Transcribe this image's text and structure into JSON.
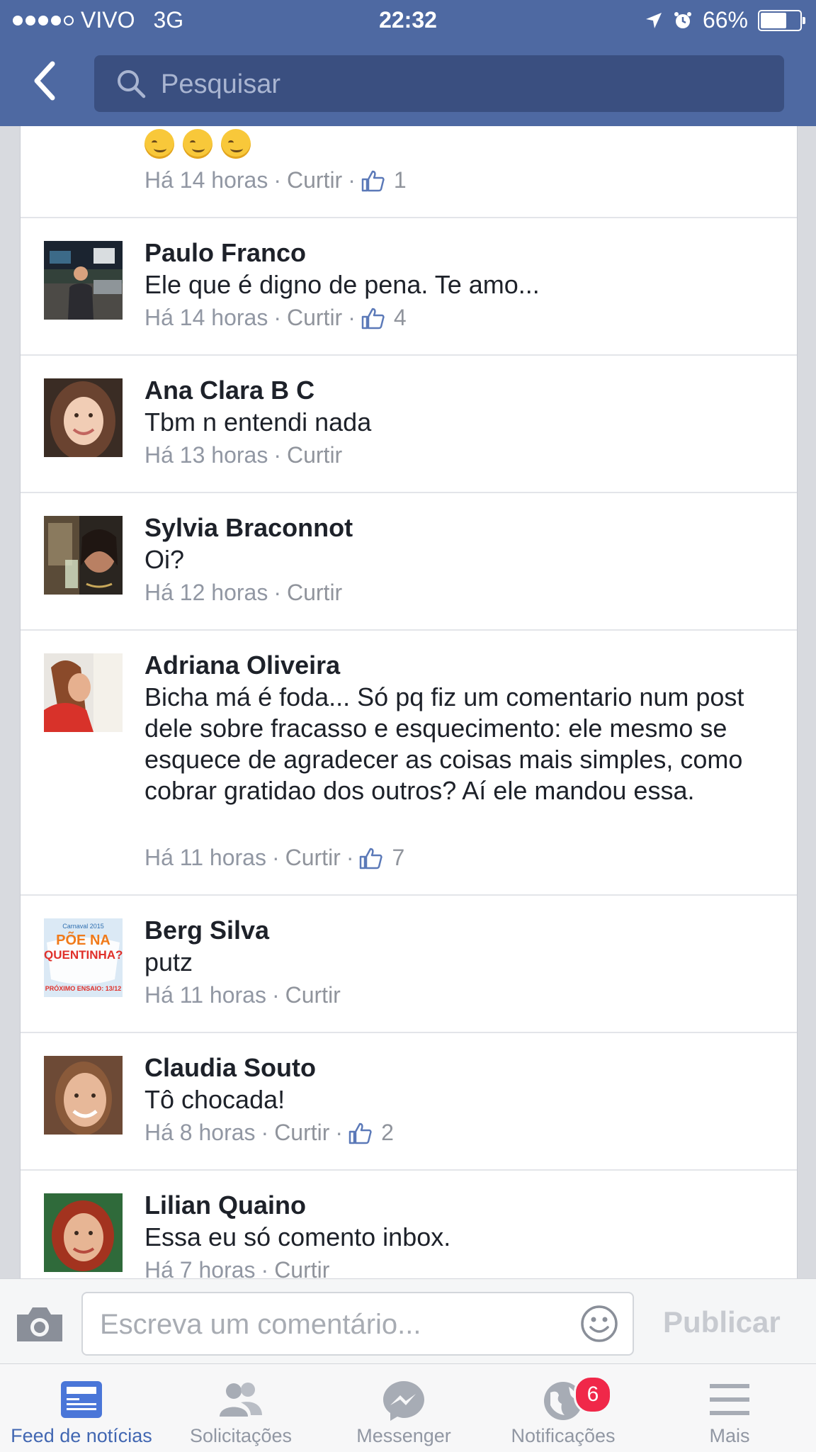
{
  "status_bar": {
    "carrier": "VIVO",
    "network": "3G",
    "time": "22:32",
    "battery": "66%",
    "battery_level": 0.66,
    "icons": [
      "location-arrow-icon",
      "alarm-icon",
      "battery-icon"
    ]
  },
  "header": {
    "back_icon": "chevron-left-icon",
    "search_placeholder": "Pesquisar"
  },
  "comments": [
    {
      "name": "",
      "text": "",
      "emojis": [
        "winking-face",
        "winking-face",
        "winking-face"
      ],
      "time": "Há 14 horas",
      "like_label": "Curtir",
      "likes": "1"
    },
    {
      "name": "Paulo Franco",
      "text": "Ele que é digno de pena. Te amo...",
      "time": "Há 14 horas",
      "like_label": "Curtir",
      "likes": "4"
    },
    {
      "name": "Ana Clara B C",
      "text": "Tbm n entendi nada",
      "time": "Há 13 horas",
      "like_label": "Curtir",
      "likes": ""
    },
    {
      "name": "Sylvia Braconnot",
      "text": "Oi?",
      "time": "Há 12 horas",
      "like_label": "Curtir",
      "likes": ""
    },
    {
      "name": "Adriana Oliveira",
      "text": "Bicha má é foda... Só pq fiz um comentario num post dele sobre fracasso e esquecimento: ele mesmo se esquece de agradecer as coisas mais simples, como cobrar gratidao dos outros? Aí ele mandou essa.",
      "time": "Há 11 horas",
      "like_label": "Curtir",
      "likes": "7"
    },
    {
      "name": "Berg Silva",
      "text": "putz",
      "time": "Há 11 horas",
      "like_label": "Curtir",
      "likes": ""
    },
    {
      "name": "Claudia Souto",
      "text": "Tô chocada!",
      "time": "Há 8 horas",
      "like_label": "Curtir",
      "likes": "2"
    },
    {
      "name": "Lilian Quaino",
      "text": "Essa eu só comento inbox.",
      "time": "Há 7 horas",
      "like_label": "Curtir",
      "likes": ""
    }
  ],
  "berg_avatar": {
    "top": "Carnaval 2015",
    "line1": "PÕE NA",
    "line2": "QUENTINHA?",
    "bottom": "PRÓXIMO ENSAIO: 13/12"
  },
  "composer": {
    "camera_icon": "camera-icon",
    "placeholder": "Escreva um comentário...",
    "smiley_icon": "smiley-icon",
    "publish_label": "Publicar"
  },
  "tabs": [
    {
      "label": "Feed de notícias",
      "icon": "news-feed-icon",
      "active": true
    },
    {
      "label": "Solicitações",
      "icon": "friend-requests-icon",
      "active": false
    },
    {
      "label": "Messenger",
      "icon": "messenger-icon",
      "active": false
    },
    {
      "label": "Notificações",
      "icon": "globe-icon",
      "active": false,
      "badge": "6"
    },
    {
      "label": "Mais",
      "icon": "menu-icon",
      "active": false
    }
  ],
  "colors": {
    "header": "#4e69a2",
    "search_bg": "#3a4f80",
    "active_tab": "#4267b2",
    "badge": "#f02849",
    "meta_text": "#9197a3"
  }
}
